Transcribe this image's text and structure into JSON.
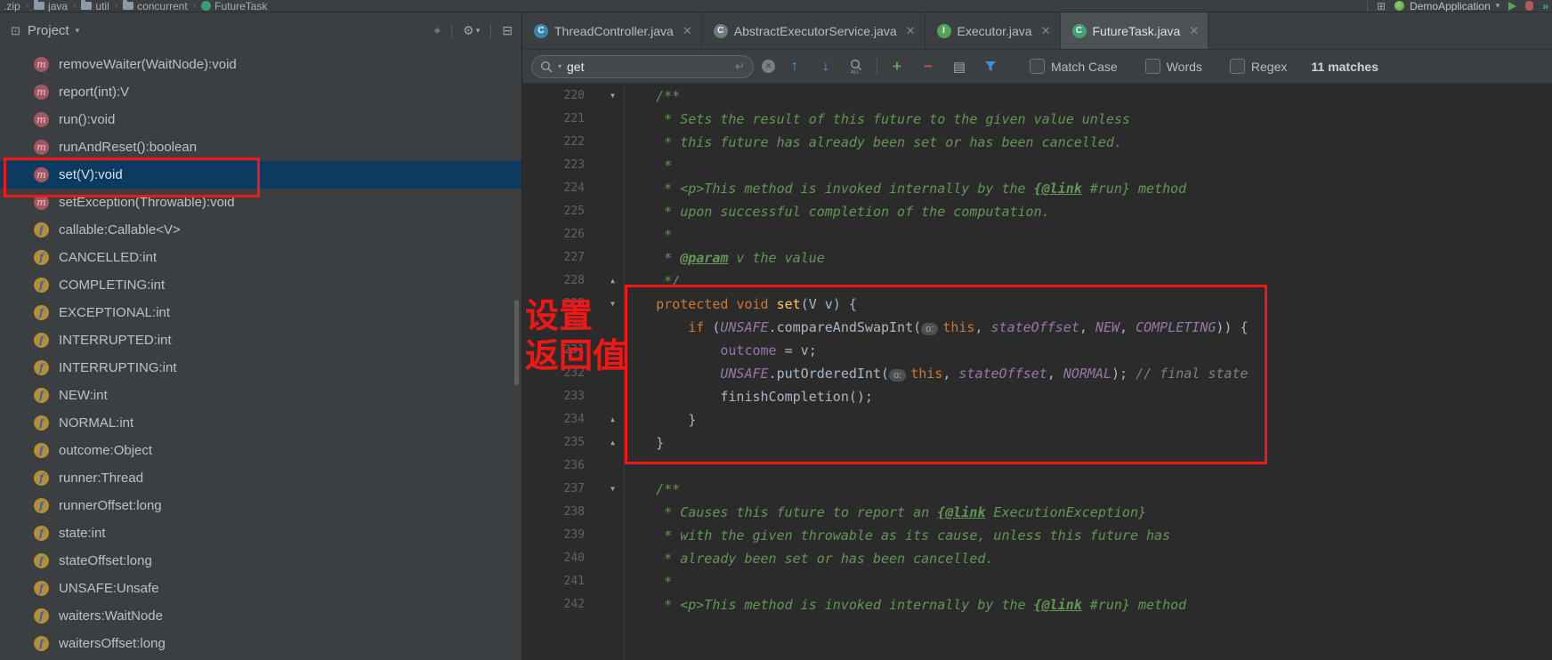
{
  "topbar": {
    "breadcrumbs": [
      {
        "label": ".zip",
        "icon": "none"
      },
      {
        "label": "java",
        "icon": "folder"
      },
      {
        "label": "util",
        "icon": "folder"
      },
      {
        "label": "concurrent",
        "icon": "folder"
      },
      {
        "label": "FutureTask",
        "icon": "class"
      }
    ],
    "run_config_label": "DemoApplication"
  },
  "project_panel": {
    "title": "Project",
    "items": [
      {
        "kind": "m",
        "label": "removeWaiter(WaitNode):void"
      },
      {
        "kind": "m",
        "label": "report(int):V"
      },
      {
        "kind": "m",
        "label": "run():void"
      },
      {
        "kind": "m",
        "label": "runAndReset():boolean"
      },
      {
        "kind": "m",
        "label": "set(V):void",
        "selected": true
      },
      {
        "kind": "m",
        "label": "setException(Throwable):void"
      },
      {
        "kind": "f",
        "label": "callable:Callable<V>"
      },
      {
        "kind": "f",
        "label": "CANCELLED:int"
      },
      {
        "kind": "f",
        "label": "COMPLETING:int"
      },
      {
        "kind": "f",
        "label": "EXCEPTIONAL:int"
      },
      {
        "kind": "f",
        "label": "INTERRUPTED:int"
      },
      {
        "kind": "f",
        "label": "INTERRUPTING:int"
      },
      {
        "kind": "f",
        "label": "NEW:int"
      },
      {
        "kind": "f",
        "label": "NORMAL:int"
      },
      {
        "kind": "f",
        "label": "outcome:Object"
      },
      {
        "kind": "f",
        "label": "runner:Thread"
      },
      {
        "kind": "f",
        "label": "runnerOffset:long"
      },
      {
        "kind": "f",
        "label": "state:int"
      },
      {
        "kind": "f",
        "label": "stateOffset:long"
      },
      {
        "kind": "f",
        "label": "UNSAFE:Unsafe"
      },
      {
        "kind": "f",
        "label": "waiters:WaitNode"
      },
      {
        "kind": "f",
        "label": "waitersOffset:long"
      }
    ]
  },
  "tabs": [
    {
      "label": "ThreadController.java",
      "icon_letter": "C",
      "icon_color": "#3a87ad",
      "active": false
    },
    {
      "label": "AbstractExecutorService.java",
      "icon_letter": "C",
      "icon_color": "#6e7b80",
      "active": false
    },
    {
      "label": "Executor.java",
      "icon_letter": "I",
      "icon_color": "#54a35a",
      "active": false
    },
    {
      "label": "FutureTask.java",
      "icon_letter": "C",
      "icon_color": "#40a373",
      "active": true
    }
  ],
  "search": {
    "query": "get",
    "options": [
      {
        "label": "Match Case"
      },
      {
        "label": "Words"
      },
      {
        "label": "Regex"
      }
    ],
    "matches": "11 matches"
  },
  "annotation": {
    "line1": "设置",
    "line2": "返回值",
    "color": "#f21717"
  },
  "editor": {
    "lines": [
      {
        "no": "220",
        "fold": "d",
        "segs": [
          [
            "    /**",
            "d"
          ]
        ]
      },
      {
        "no": "221",
        "segs": [
          [
            "     * Sets the result of this future to the given value unless",
            "d"
          ]
        ]
      },
      {
        "no": "222",
        "segs": [
          [
            "     * this future has already been set or has been cancelled.",
            "d"
          ]
        ]
      },
      {
        "no": "223",
        "segs": [
          [
            "     *",
            "d"
          ]
        ]
      },
      {
        "no": "224",
        "segs": [
          [
            "     * <p>This method is invoked internally by the ",
            "d"
          ],
          [
            "{@link",
            "t"
          ],
          [
            " #run} method",
            "d"
          ]
        ]
      },
      {
        "no": "225",
        "segs": [
          [
            "     * upon successful completion of the computation.",
            "d"
          ]
        ]
      },
      {
        "no": "226",
        "segs": [
          [
            "     *",
            "d"
          ]
        ]
      },
      {
        "no": "227",
        "segs": [
          [
            "     * ",
            "d"
          ],
          [
            "@param",
            "t"
          ],
          [
            " v the value",
            "d"
          ]
        ]
      },
      {
        "no": "228",
        "fold": "u",
        "segs": [
          [
            "     */",
            "d"
          ]
        ]
      },
      {
        "no": "229",
        "fold": "d",
        "segs": [
          [
            "    ",
            "p"
          ],
          [
            "protected",
            "k"
          ],
          [
            " ",
            "p"
          ],
          [
            "void",
            "k"
          ],
          [
            " ",
            "p"
          ],
          [
            "set",
            "m"
          ],
          [
            "(V v) {",
            "p"
          ]
        ]
      },
      {
        "no": "230",
        "segs": [
          [
            "        ",
            "p"
          ],
          [
            "if",
            "k"
          ],
          [
            " (",
            "p"
          ],
          [
            "UNSAFE",
            "s"
          ],
          [
            ".compareAndSwapInt(",
            "p"
          ],
          [
            "o:",
            "h"
          ],
          [
            "this",
            "k"
          ],
          [
            ", ",
            "p"
          ],
          [
            "stateOffset",
            "s"
          ],
          [
            ", ",
            "p"
          ],
          [
            "NEW",
            "s"
          ],
          [
            ", ",
            "p"
          ],
          [
            "COMPLETING",
            "s"
          ],
          [
            ")) {",
            "p"
          ]
        ]
      },
      {
        "no": "231",
        "segs": [
          [
            "            ",
            "p"
          ],
          [
            "outcome",
            "f"
          ],
          [
            " = v;",
            "p"
          ]
        ]
      },
      {
        "no": "232",
        "segs": [
          [
            "            ",
            "p"
          ],
          [
            "UNSAFE",
            "s"
          ],
          [
            ".putOrderedInt(",
            "p"
          ],
          [
            "o:",
            "h"
          ],
          [
            "this",
            "k"
          ],
          [
            ", ",
            "p"
          ],
          [
            "stateOffset",
            "s"
          ],
          [
            ", ",
            "p"
          ],
          [
            "NORMAL",
            "s"
          ],
          [
            "); ",
            "p"
          ],
          [
            "// final state",
            "c"
          ]
        ]
      },
      {
        "no": "233",
        "segs": [
          [
            "            finishCompletion();",
            "p"
          ]
        ]
      },
      {
        "no": "234",
        "fold": "u",
        "segs": [
          [
            "        }",
            "p"
          ]
        ]
      },
      {
        "no": "235",
        "fold": "u",
        "segs": [
          [
            "    }",
            "p"
          ]
        ]
      },
      {
        "no": "236",
        "segs": []
      },
      {
        "no": "237",
        "fold": "d",
        "segs": [
          [
            "    /**",
            "d"
          ]
        ]
      },
      {
        "no": "238",
        "segs": [
          [
            "     * Causes this future to report an ",
            "d"
          ],
          [
            "{@link",
            "t"
          ],
          [
            " ExecutionException}",
            "d"
          ]
        ]
      },
      {
        "no": "239",
        "segs": [
          [
            "     * with the given throwable as its cause, unless this future has",
            "d"
          ]
        ]
      },
      {
        "no": "240",
        "segs": [
          [
            "     * already been set or has been cancelled.",
            "d"
          ]
        ]
      },
      {
        "no": "241",
        "segs": [
          [
            "     *",
            "d"
          ]
        ]
      },
      {
        "no": "242",
        "segs": [
          [
            "     * <p>This method is invoked internally by the ",
            "d"
          ],
          [
            "{@link",
            "t"
          ],
          [
            " #run} method",
            "d"
          ]
        ]
      }
    ]
  }
}
